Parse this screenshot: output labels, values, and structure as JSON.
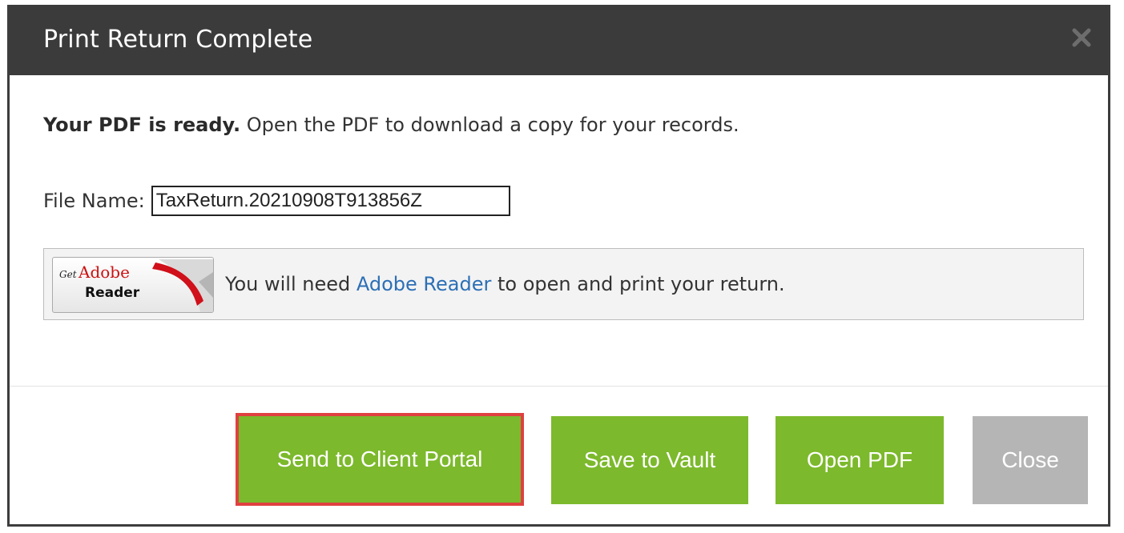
{
  "dialog": {
    "title": "Print Return Complete",
    "close_icon": "close-x-icon"
  },
  "message": {
    "bold": "Your PDF is ready.",
    "rest": " Open the PDF to download a copy for your records."
  },
  "file": {
    "label": "File Name:",
    "value": "TaxReturn.20210908T913856Z"
  },
  "adobe": {
    "badge_get": "Get",
    "badge_adobe": "Adobe",
    "badge_reader": "Reader",
    "text_before": "You will need ",
    "link": "Adobe Reader",
    "text_after": " to open and print your return."
  },
  "buttons": {
    "send": "Send to Client Portal",
    "vault": "Save to Vault",
    "open": "Open PDF",
    "close": "Close"
  },
  "colors": {
    "header": "#3b3b3b",
    "primary": "#7cb92c",
    "disabled": "#b5b5b5",
    "highlight": "#e04040",
    "link": "#2c6fb6"
  }
}
